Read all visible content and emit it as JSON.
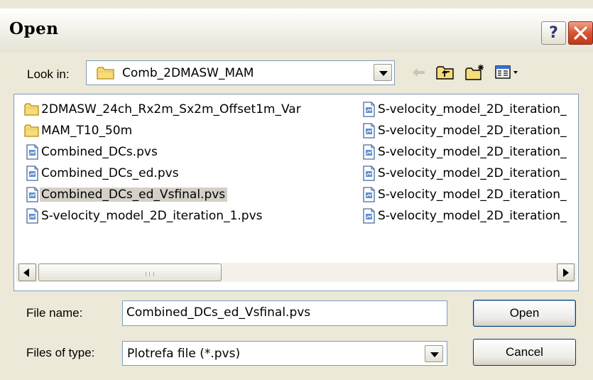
{
  "window": {
    "title": "Open"
  },
  "look_in": {
    "label": "Look in:",
    "value": "Comb_2DMASW_MAM"
  },
  "toolbar": [
    "back-icon",
    "up-folder-icon",
    "new-folder-icon",
    "view-menu-icon"
  ],
  "files_left": [
    {
      "name": "2DMASW_24ch_Rx2m_Sx2m_Offset1m_Var",
      "icon": "folder-icon"
    },
    {
      "name": "MAM_T10_50m",
      "icon": "folder-icon"
    },
    {
      "name": "Combined_DCs.pvs",
      "icon": "pvs-file-icon"
    },
    {
      "name": "Combined_DCs_ed.pvs",
      "icon": "pvs-file-icon"
    },
    {
      "name": "Combined_DCs_ed_Vsfinal.pvs",
      "icon": "pvs-file-icon",
      "selected": true
    },
    {
      "name": "S-velocity_model_2D_iteration_1.pvs",
      "icon": "pvs-file-icon"
    }
  ],
  "files_right": [
    {
      "name": "S-velocity_model_2D_iteration_",
      "icon": "pvs-file-icon"
    },
    {
      "name": "S-velocity_model_2D_iteration_",
      "icon": "pvs-file-icon"
    },
    {
      "name": "S-velocity_model_2D_iteration_",
      "icon": "pvs-file-icon"
    },
    {
      "name": "S-velocity_model_2D_iteration_",
      "icon": "pvs-file-icon"
    },
    {
      "name": "S-velocity_model_2D_iteration_",
      "icon": "pvs-file-icon"
    },
    {
      "name": "S-velocity_model_2D_iteration_",
      "icon": "pvs-file-icon"
    }
  ],
  "file_name": {
    "label": "File name:",
    "value": "Combined_DCs_ed_Vsfinal.pvs"
  },
  "file_type": {
    "label": "Files of type:",
    "value": "Plotrefa file (*.pvs)"
  },
  "buttons": {
    "open": "Open",
    "cancel": "Cancel",
    "help": "?"
  },
  "colors": {
    "selection": "#d4d0c8",
    "dialog_bg": "#ece9d8",
    "border": "#7f9db9"
  }
}
